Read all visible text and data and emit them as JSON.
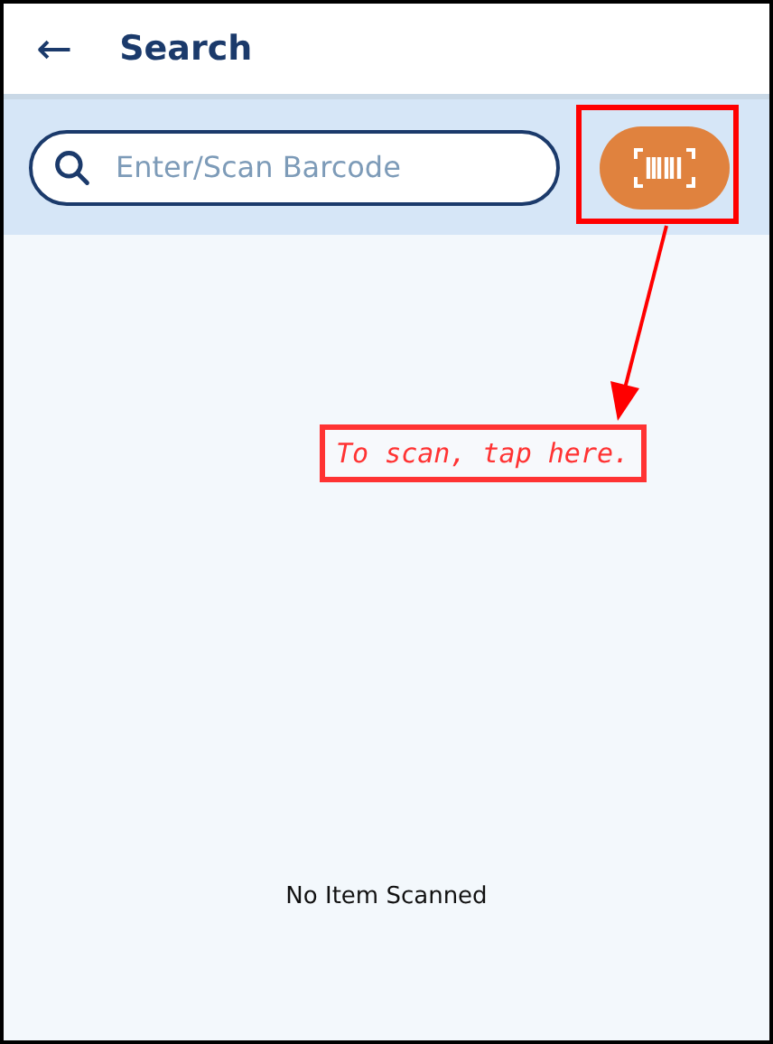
{
  "header": {
    "back_icon": "←",
    "title": "Search"
  },
  "search": {
    "placeholder": "Enter/Scan Barcode"
  },
  "annotation": {
    "text": "To scan, tap here."
  },
  "empty_message": "No Item Scanned"
}
